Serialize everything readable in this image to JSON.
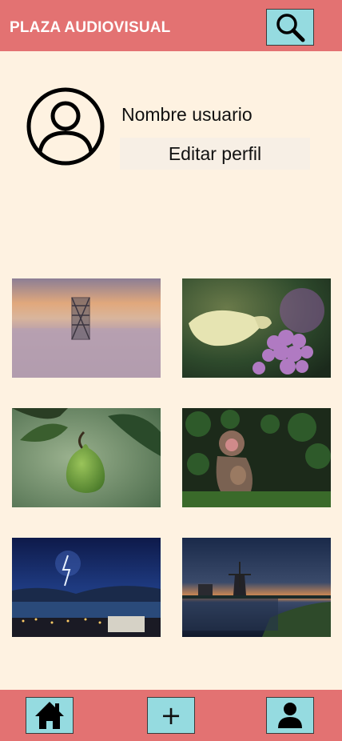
{
  "header": {
    "title": "PLAZA AUDIOVISUAL",
    "search_icon": "search-icon"
  },
  "profile": {
    "username": "Nombre usuario",
    "edit_label": "Editar perfil",
    "avatar_icon": "user-circle-icon"
  },
  "gallery": {
    "items": [
      {
        "subject": "tower-in-fog"
      },
      {
        "subject": "butterfly-on-flower"
      },
      {
        "subject": "pear-on-branch"
      },
      {
        "subject": "monkey-with-baby"
      },
      {
        "subject": "lightning-over-lake"
      },
      {
        "subject": "windmill-at-dusk"
      }
    ]
  },
  "nav": {
    "home_icon": "home-icon",
    "add_icon": "plus-icon",
    "add_label": "+",
    "profile_icon": "user-icon"
  },
  "colors": {
    "header_bg": "#e37272",
    "background": "#fef2e1",
    "button_bg": "#95dbe0"
  }
}
